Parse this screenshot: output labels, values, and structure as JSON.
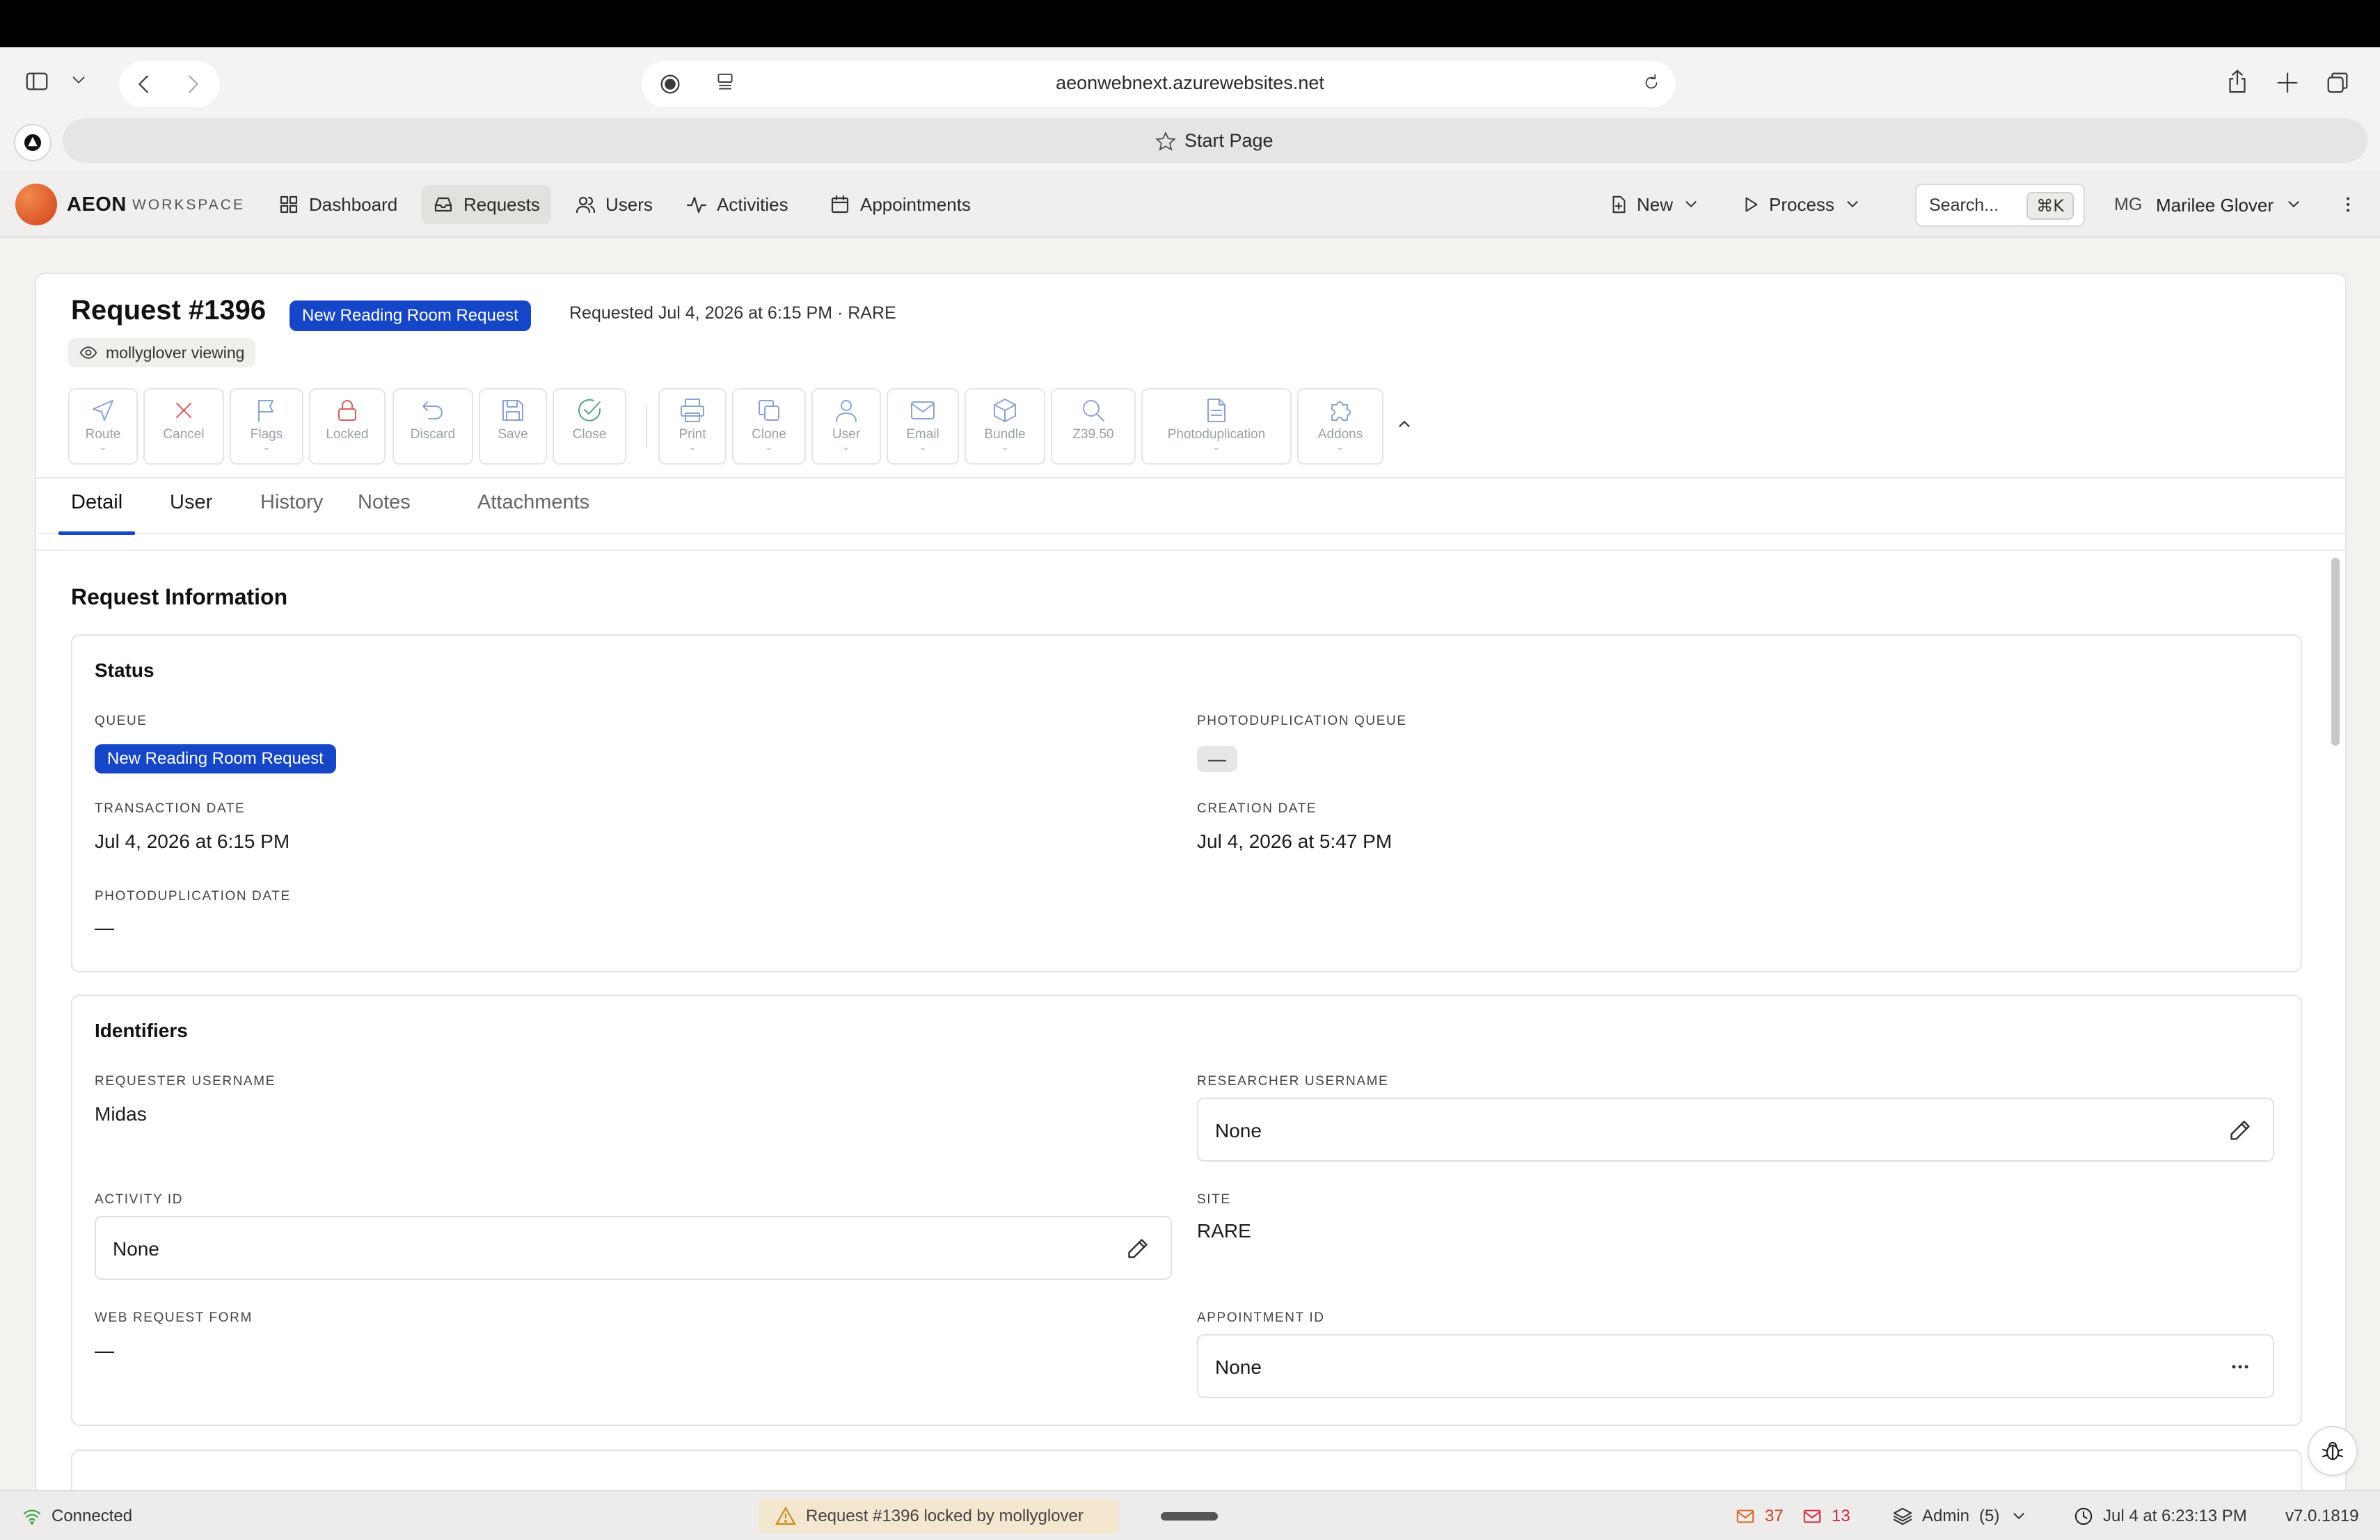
{
  "browser": {
    "url": "aeonwebnext.azurewebsites.net",
    "start_page": "Start Page"
  },
  "app": {
    "brand": "AEON",
    "brand_sub": "WORKSPACE",
    "nav": [
      {
        "label": "Dashboard",
        "icon": "grid-icon"
      },
      {
        "label": "Requests",
        "icon": "inbox-icon",
        "active": true
      },
      {
        "label": "Users",
        "icon": "users-icon"
      },
      {
        "label": "Activities",
        "icon": "activity-icon"
      },
      {
        "label": "Appointments",
        "icon": "calendar-icon"
      }
    ],
    "new_label": "New",
    "process_label": "Process",
    "search_placeholder": "Search...",
    "search_shortcut": "⌘K",
    "user_initials": "MG",
    "user_name": "Marilee Glover"
  },
  "request": {
    "title": "Request #1396",
    "queue_badge": "New Reading Room Request",
    "meta": "Requested Jul 4, 2026 at 6:15 PM  ·  RARE",
    "viewing": "mollyglover viewing"
  },
  "toolbar": {
    "route": "Route",
    "cancel": "Cancel",
    "flags": "Flags",
    "locked": "Locked",
    "discard": "Discard",
    "save": "Save",
    "close": "Close",
    "print": "Print",
    "clone": "Clone",
    "user": "User",
    "email": "Email",
    "bundle": "Bundle",
    "z3950": "Z39.50",
    "photodup": "Photoduplication",
    "addons": "Addons"
  },
  "tabs": {
    "detail": "Detail",
    "user": "User",
    "history": "History",
    "notes": "Notes",
    "attachments": "Attachments"
  },
  "section": {
    "title": "Request Information",
    "status": {
      "title": "Status",
      "queue_label": "QUEUE",
      "queue_value": "New Reading Room Request",
      "photo_queue_label": "PHOTODUPLICATION QUEUE",
      "photo_queue_value": "—",
      "transaction_label": "TRANSACTION DATE",
      "transaction_value": "Jul 4, 2026 at 6:15 PM",
      "creation_label": "CREATION DATE",
      "creation_value": "Jul 4, 2026 at 5:47 PM",
      "photo_date_label": "PHOTODUPLICATION DATE",
      "photo_date_value": "—"
    },
    "identifiers": {
      "title": "Identifiers",
      "requester_label": "REQUESTER USERNAME",
      "requester_value": "Midas",
      "researcher_label": "RESEARCHER USERNAME",
      "researcher_value": "None",
      "activity_label": "ACTIVITY ID",
      "activity_value": "None",
      "site_label": "SITE",
      "site_value": "RARE",
      "webform_label": "WEB REQUEST FORM",
      "webform_value": "—",
      "appointment_label": "APPOINTMENT ID",
      "appointment_value": "None"
    }
  },
  "statusbar": {
    "connection": "Connected",
    "lock_notice": "Request #1396 locked by mollyglover",
    "mail_count_1": "37",
    "mail_count_2": "13",
    "role": "Admin",
    "role_count": "(5)",
    "clock": "Jul 4 at 6:23:13 PM",
    "version": "v7.0.1819"
  },
  "colors": {
    "accent": "#1546c7",
    "warning": "#d08a1a",
    "danger": "#e05a5a",
    "success": "#54a873"
  }
}
